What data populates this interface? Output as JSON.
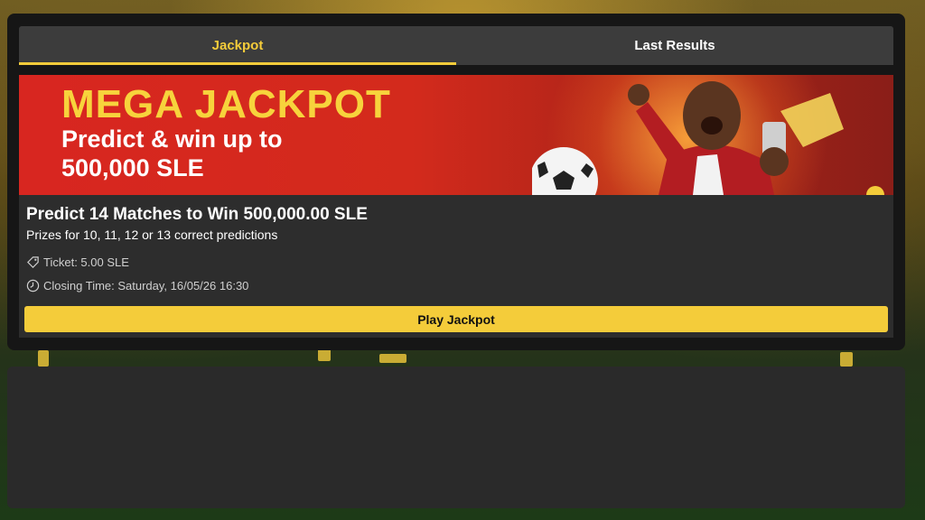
{
  "tabs": [
    {
      "label": "Jackpot",
      "active": true
    },
    {
      "label": "Last Results",
      "active": false
    }
  ],
  "banner": {
    "title": "MEGA JACKPOT",
    "line1": "Predict & win up to",
    "line2": "500,000 SLE"
  },
  "jackpot": {
    "heading": "Predict 14 Matches to Win 500,000.00 SLE",
    "subheading": "Prizes for 10, 11, 12 or 13 correct predictions",
    "ticket": "Ticket: 5.00 SLE",
    "closing": "Closing Time: Saturday, 16/05/26 16:30",
    "play_label": "Play Jackpot"
  },
  "colors": {
    "accent": "#f4cc3a",
    "banner_red": "#d82620",
    "panel": "#2d2d2d"
  },
  "icons": {
    "ticket": "tag-icon",
    "closing": "clock-icon"
  }
}
